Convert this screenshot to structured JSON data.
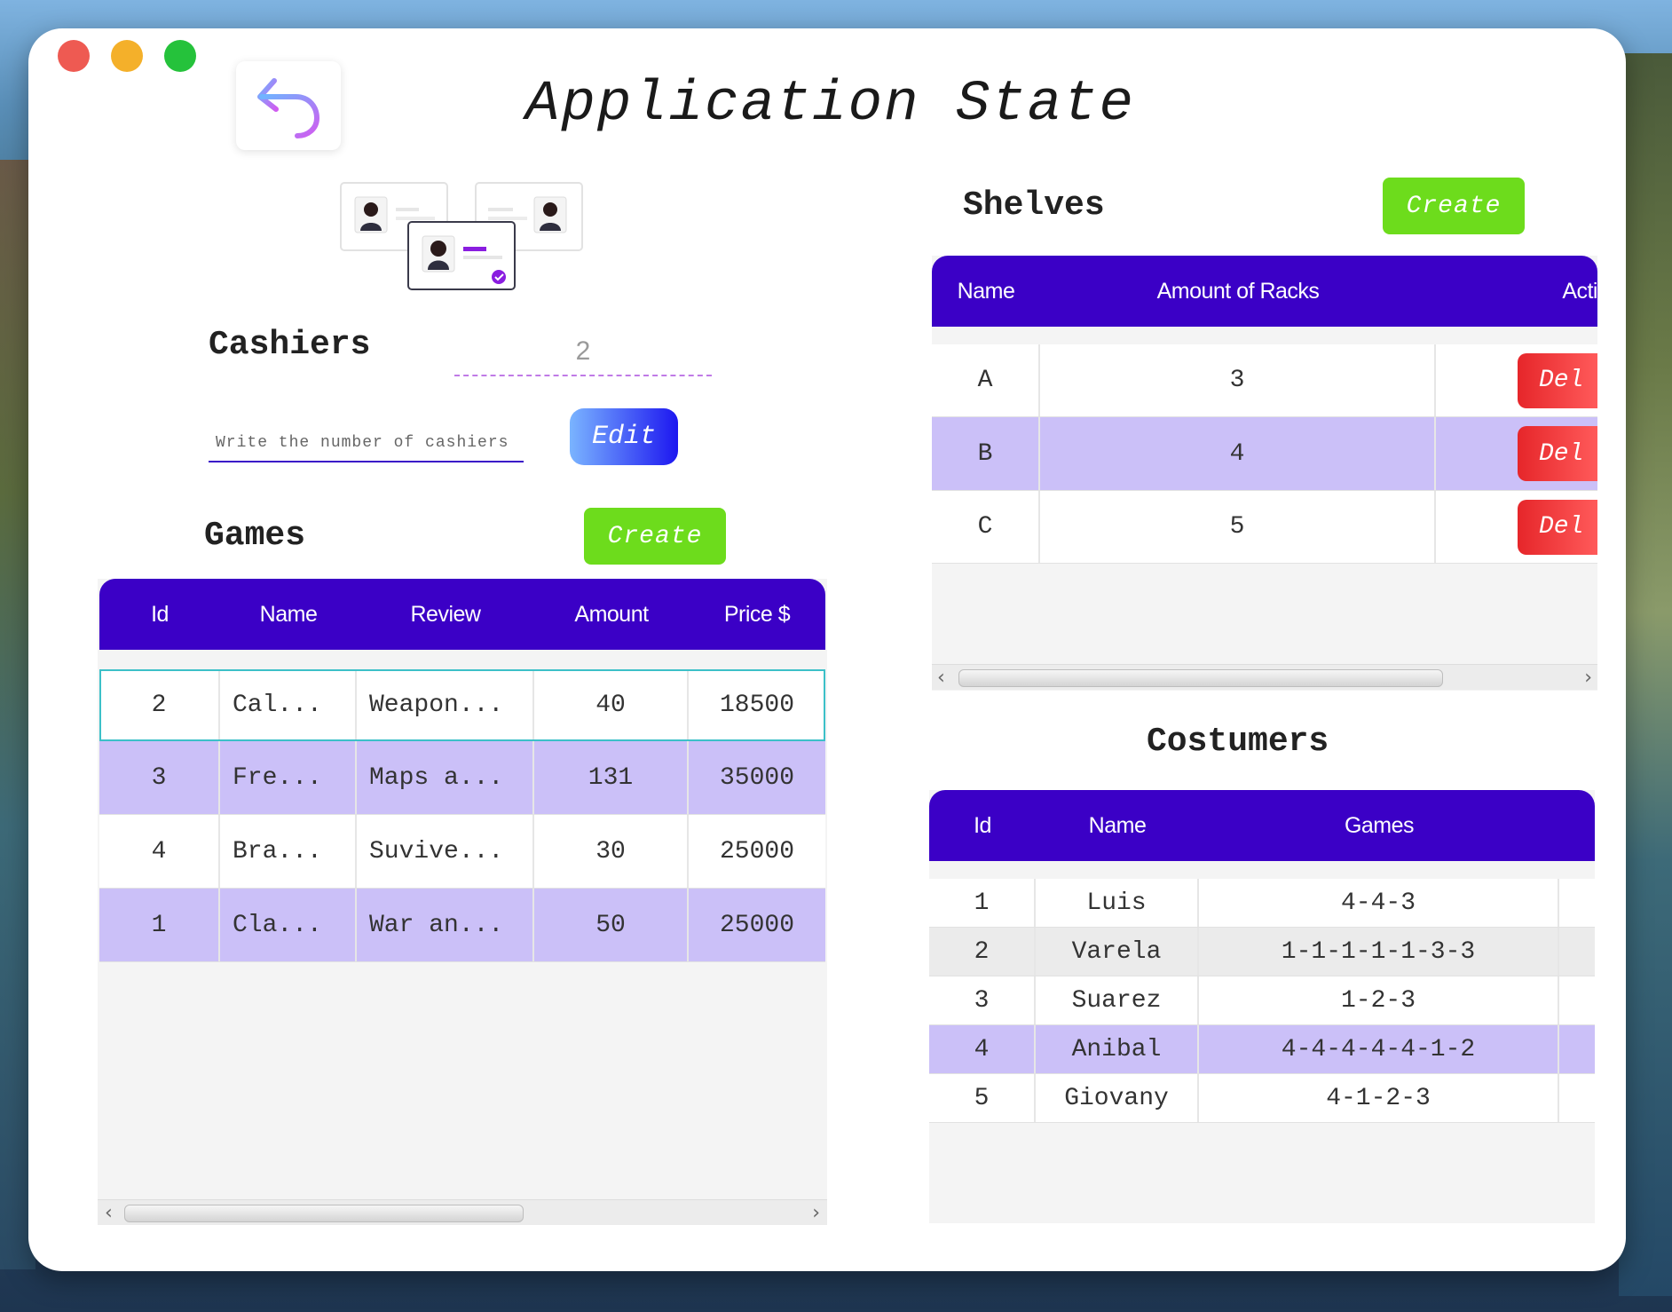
{
  "header": {
    "title": "Application State"
  },
  "cashiers": {
    "title": "Cashiers",
    "count": "2",
    "input_placeholder": "Write the number of cashiers",
    "edit_label": "Edit"
  },
  "games": {
    "title": "Games",
    "create_label": "Create",
    "columns": [
      "Id",
      "Name",
      "Review",
      "Amount",
      "Price $"
    ],
    "rows": [
      [
        "2",
        "Cal...",
        "Weapon...",
        "40",
        "18500"
      ],
      [
        "3",
        "Fre...",
        "Maps a...",
        "131",
        "35000"
      ],
      [
        "4",
        "Bra...",
        "Suvive...",
        "30",
        "25000"
      ],
      [
        "1",
        "Cla...",
        "War an...",
        "50",
        "25000"
      ]
    ]
  },
  "shelves": {
    "title": "Shelves",
    "create_label": "Create",
    "columns": [
      "Name",
      "Amount of Racks",
      "Acti"
    ],
    "rows": [
      {
        "name": "A",
        "racks": "3",
        "action": "Del"
      },
      {
        "name": "B",
        "racks": "4",
        "action": "Del"
      },
      {
        "name": "C",
        "racks": "5",
        "action": "Del"
      }
    ]
  },
  "costumers": {
    "title": "Costumers",
    "columns": [
      "Id",
      "Name",
      "Games"
    ],
    "rows": [
      [
        "1",
        "Luis",
        "4-4-3"
      ],
      [
        "2",
        "Varela",
        "1-1-1-1-1-3-3"
      ],
      [
        "3",
        "Suarez",
        "1-2-3"
      ],
      [
        "4",
        "Anibal",
        "4-4-4-4-4-1-2"
      ],
      [
        "5",
        "Giovany",
        "4-1-2-3"
      ]
    ]
  },
  "scroll": {
    "left": "‹",
    "right": "›"
  },
  "colors": {
    "header": "#3b00c6",
    "highlight": "#cbc0f8",
    "create": "#6ddc1c",
    "delete": "#e6262a"
  }
}
